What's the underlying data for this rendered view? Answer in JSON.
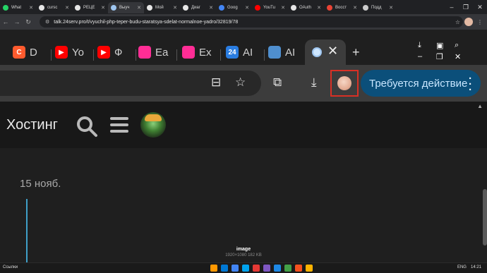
{
  "outer_browser": {
    "tabs": [
      {
        "label": "What",
        "color": "#25d366"
      },
      {
        "label": "cursc",
        "color": "#e6e6e6"
      },
      {
        "label": "РЕЦЕ",
        "color": "#e6e6e6"
      },
      {
        "label": "Выуч",
        "color": "#9ec5ef",
        "active": true
      },
      {
        "label": "Мой",
        "color": "#e6e6e6"
      },
      {
        "label": "Диаг",
        "color": "#e6e6e6"
      },
      {
        "label": "Goog",
        "color": "#4285f4"
      },
      {
        "label": "YouTu",
        "color": "#ff0000"
      },
      {
        "label": "OAuth",
        "color": "#e6e6e6"
      },
      {
        "label": "Восст",
        "color": "#ea4335"
      },
      {
        "label": "Подд",
        "color": "#cccccc"
      }
    ],
    "url": "talk.24serv.pro/t/vyuchil-php-teper-budu-staratsya-sdelat-normalnoe-yadro/32819/78",
    "window_controls": {
      "minimize": "–",
      "maximize": "❐",
      "close": "✕"
    }
  },
  "inner_browser": {
    "tabs": [
      {
        "label": "D",
        "badge": "C",
        "color": "#ff5b2e"
      },
      {
        "label": "Yo",
        "badge": "▶",
        "color": "#ff0000"
      },
      {
        "label": "Ф",
        "badge": "▶",
        "color": "#ff0000"
      },
      {
        "label": "Ea",
        "badge": "",
        "color": "#ff2d95"
      },
      {
        "label": "Ex",
        "badge": "",
        "color": "#ff2d95"
      },
      {
        "label": "AI",
        "badge": "24",
        "color": "#2a7de1"
      },
      {
        "label": "AI",
        "badge": "",
        "color": "#4f8fcf"
      }
    ],
    "active_tab_close": "✕",
    "new_tab": "+",
    "action_button_label": "Требуется действие"
  },
  "site": {
    "title": "Хостинг",
    "date": "15 нояб."
  },
  "lightbox": {
    "title": "image",
    "meta": "1920×1080 182 KB"
  },
  "taskbar": {
    "links_label": "Ссылки",
    "lang": "ENG",
    "time": "14:21",
    "app_colors": [
      "#ff9800",
      "#0078d4",
      "#4285f4",
      "#00a2ed",
      "#e53935",
      "#7e57c2",
      "#1e88e5",
      "#43a047",
      "#f4511e",
      "#ffb300"
    ]
  }
}
